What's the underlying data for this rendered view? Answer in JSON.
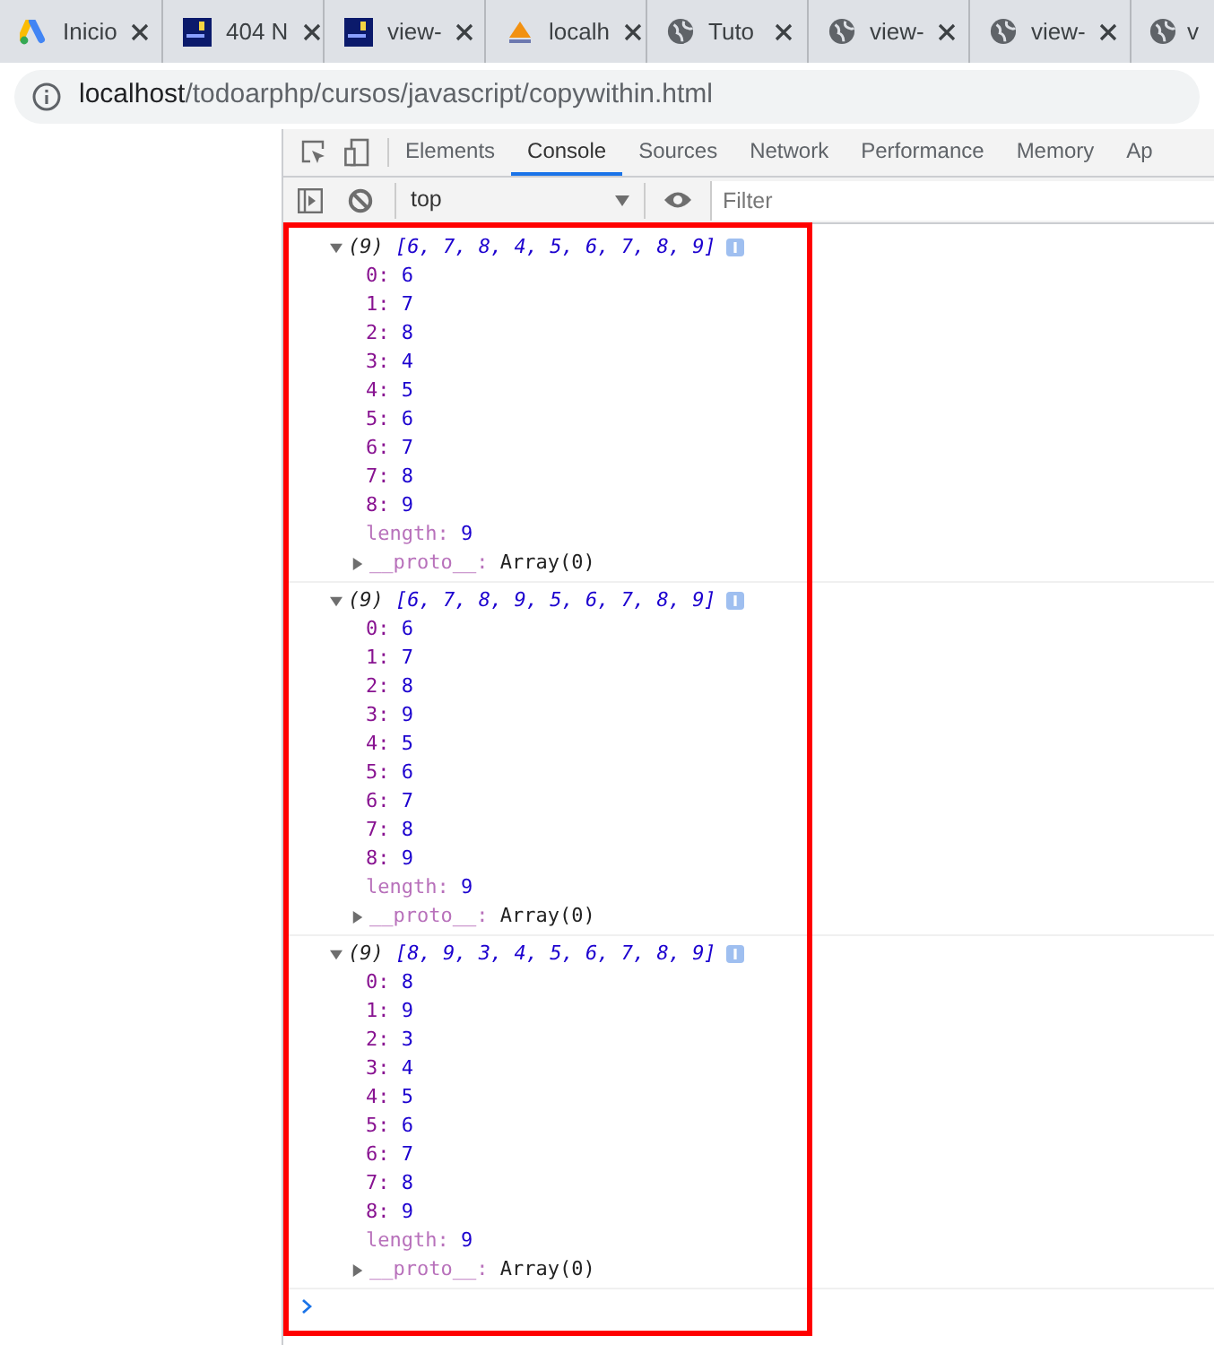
{
  "browser_tabs": [
    {
      "title": "Inicio"
    },
    {
      "title": "404 N"
    },
    {
      "title": "view-"
    },
    {
      "title": "localh"
    },
    {
      "title": "Tuto"
    },
    {
      "title": "view-"
    },
    {
      "title": "view-"
    },
    {
      "title": "v"
    }
  ],
  "address_bar": {
    "host": "localhost",
    "path": "/todoarphp/cursos/javascript/copywithin.html"
  },
  "devtools": {
    "tabs": [
      {
        "label": "Elements",
        "selected": false
      },
      {
        "label": "Console",
        "selected": true
      },
      {
        "label": "Sources",
        "selected": false
      },
      {
        "label": "Network",
        "selected": false
      },
      {
        "label": "Performance",
        "selected": false
      },
      {
        "label": "Memory",
        "selected": false
      },
      {
        "label": "Ap",
        "selected": false
      }
    ],
    "context": "top",
    "filter_placeholder": "Filter"
  },
  "console": {
    "entries": [
      {
        "count": "(9)",
        "preview": "[6, 7, 8, 4, 5, 6, 7, 8, 9]",
        "expanded": true,
        "properties": [
          {
            "kind": "index",
            "key": "0:",
            "value": "6"
          },
          {
            "kind": "index",
            "key": "1:",
            "value": "7"
          },
          {
            "kind": "index",
            "key": "2:",
            "value": "8"
          },
          {
            "kind": "index",
            "key": "3:",
            "value": "4"
          },
          {
            "kind": "index",
            "key": "4:",
            "value": "5"
          },
          {
            "kind": "index",
            "key": "5:",
            "value": "6"
          },
          {
            "kind": "index",
            "key": "6:",
            "value": "7"
          },
          {
            "kind": "index",
            "key": "7:",
            "value": "8"
          },
          {
            "kind": "index",
            "key": "8:",
            "value": "9"
          },
          {
            "kind": "length",
            "key": "length:",
            "value": "9"
          },
          {
            "kind": "proto",
            "key": "__proto__:",
            "value": "Array(0)",
            "expanded": false
          }
        ]
      },
      {
        "count": "(9)",
        "preview": "[6, 7, 8, 9, 5, 6, 7, 8, 9]",
        "expanded": true,
        "properties": [
          {
            "kind": "index",
            "key": "0:",
            "value": "6"
          },
          {
            "kind": "index",
            "key": "1:",
            "value": "7"
          },
          {
            "kind": "index",
            "key": "2:",
            "value": "8"
          },
          {
            "kind": "index",
            "key": "3:",
            "value": "9"
          },
          {
            "kind": "index",
            "key": "4:",
            "value": "5"
          },
          {
            "kind": "index",
            "key": "5:",
            "value": "6"
          },
          {
            "kind": "index",
            "key": "6:",
            "value": "7"
          },
          {
            "kind": "index",
            "key": "7:",
            "value": "8"
          },
          {
            "kind": "index",
            "key": "8:",
            "value": "9"
          },
          {
            "kind": "length",
            "key": "length:",
            "value": "9"
          },
          {
            "kind": "proto",
            "key": "__proto__:",
            "value": "Array(0)",
            "expanded": false
          }
        ]
      },
      {
        "count": "(9)",
        "preview": "[8, 9, 3, 4, 5, 6, 7, 8, 9]",
        "expanded": true,
        "properties": [
          {
            "kind": "index",
            "key": "0:",
            "value": "8"
          },
          {
            "kind": "index",
            "key": "1:",
            "value": "9"
          },
          {
            "kind": "index",
            "key": "2:",
            "value": "3"
          },
          {
            "kind": "index",
            "key": "3:",
            "value": "4"
          },
          {
            "kind": "index",
            "key": "4:",
            "value": "5"
          },
          {
            "kind": "index",
            "key": "5:",
            "value": "6"
          },
          {
            "kind": "index",
            "key": "6:",
            "value": "7"
          },
          {
            "kind": "index",
            "key": "7:",
            "value": "8"
          },
          {
            "kind": "index",
            "key": "8:",
            "value": "9"
          },
          {
            "kind": "length",
            "key": "length:",
            "value": "9"
          },
          {
            "kind": "proto",
            "key": "__proto__:",
            "value": "Array(0)",
            "expanded": false
          }
        ]
      }
    ]
  }
}
